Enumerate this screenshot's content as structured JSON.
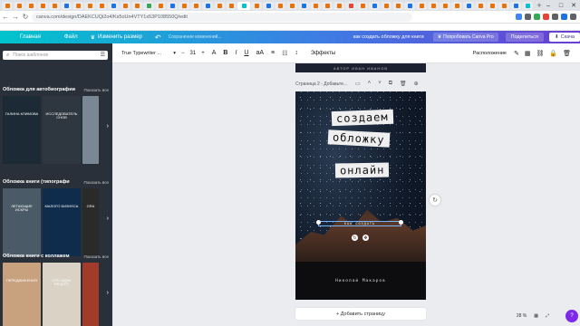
{
  "browser": {
    "tab_favicon_colors": [
      "#e8710a",
      "#e8710a",
      "#e8710a",
      "#e8710a",
      "#e8710a",
      "#1a73e8",
      "#e8710a",
      "#e8710a",
      "#e8710a",
      "#1a73e8",
      "#e8710a",
      "#e8710a",
      "#34a853",
      "#e8710a",
      "#1a73e8",
      "#e8710a",
      "#e8710a",
      "#1a73e8",
      "#e8710a",
      "#e8710a",
      "#00c4cc",
      "#e8710a",
      "#1a73e8",
      "#e8710a",
      "#e8710a",
      "#1a73e8",
      "#e8710a",
      "#e8710a",
      "#e8710a",
      "#ea4335",
      "#e8710a",
      "#1a73e8",
      "#e8710a",
      "#e8710a",
      "#1a73e8",
      "#e8710a",
      "#e8710a",
      "#e8710a",
      "#e8710a",
      "#1a73e8",
      "#e8710a",
      "#e8710a",
      "#e8710a",
      "#1a73e8",
      "#00c4cc"
    ],
    "new_tab": "+",
    "url": "canva.com/design/DAEKCUQi2o4/Ks5oUn4VTY1x53P108550Q/edit",
    "back_icon": "arrow-left-icon",
    "forward_icon": "arrow-right-icon",
    "reload_icon": "reload-icon",
    "ext_colors": [
      "#4285f4",
      "#5f6368",
      "#34a853",
      "#ea4335",
      "#5f6368",
      "#1a73e8",
      "#5f6368"
    ]
  },
  "canva_top": {
    "home": "Главная",
    "file": "Файл",
    "resize": "Изменить размер",
    "undo_icon": "undo-icon",
    "saved": "Сохранение изменений...",
    "doc_title": "как создать обложку для книги",
    "pro_button": "Попробовать Canva Pro",
    "share_button": "Поделиться",
    "download_button": "Скача",
    "gradient": [
      "#00c4cc",
      "#3d7de4",
      "#6a3ed1"
    ]
  },
  "sidebar": {
    "search_placeholder": "Поиск шаблонов",
    "sections": [
      {
        "title": "Обложка для автобиографии",
        "show_all": "Показать все",
        "thumbs": [
          {
            "label": "ГАЛИНА КЛИМОВА",
            "color": "#1b2a35"
          },
          {
            "label": "ИССЛЕДОВАТЕЛЬ СНОВ",
            "color": "#2e3640"
          },
          {
            "label": "",
            "color": "#7a8794"
          }
        ]
      },
      {
        "title": "Обложка книги (типографи",
        "show_all": "Показать все",
        "thumbs": [
          {
            "label": "ЛЕТАЮЩИЕ ИСКРЫ",
            "color": "#4a5a66"
          },
          {
            "label": "МАЛОГО БИЗНЕСА",
            "color": "#0f2c4c"
          },
          {
            "label": "GRA",
            "color": "#2a2a2a"
          }
        ]
      },
      {
        "title": "Обложка книги с коллажем",
        "show_all": "Показать все",
        "thumbs": [
          {
            "label": "ПЕРЕДВИЖЕНИЯ",
            "color": "#c8a27e"
          },
          {
            "label": "СТО ОДИН РЕЦЕПТ",
            "color": "#d9d2c5"
          },
          {
            "label": "",
            "color": "#a33b2b"
          }
        ]
      }
    ]
  },
  "toolbar": {
    "font": "True Typewriter ...",
    "font_size": "31",
    "minus": "−",
    "plus": "+",
    "effects": "Эффекты",
    "layout": "Расположение"
  },
  "canvas": {
    "prev_page_text": "АВТОР ИВАН ИВАНОВ",
    "page_label": "Страница 2 - Добавьте...",
    "title_words": [
      "создаем",
      "обложку",
      "онлайн"
    ],
    "subtitle": "КАК СОЗДАТЬ",
    "author": "Николай Макаров",
    "add_page": "+ Добавить страницу",
    "zoom": "28 %"
  }
}
